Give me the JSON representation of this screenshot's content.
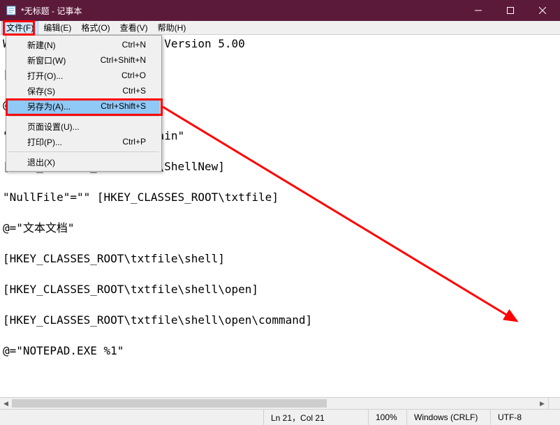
{
  "titlebar": {
    "title": "*无标题 - 记事本"
  },
  "menubar": {
    "file": "文件(F)",
    "edit": "编辑(E)",
    "format": "格式(O)",
    "view": "查看(V)",
    "help": "帮助(H)"
  },
  "dropdown": {
    "new": {
      "label": "新建(N)",
      "shortcut": "Ctrl+N"
    },
    "newwin": {
      "label": "新窗口(W)",
      "shortcut": "Ctrl+Shift+N"
    },
    "open": {
      "label": "打开(O)...",
      "shortcut": "Ctrl+O"
    },
    "save": {
      "label": "保存(S)",
      "shortcut": "Ctrl+S"
    },
    "saveas": {
      "label": "另存为(A)...",
      "shortcut": "Ctrl+Shift+S"
    },
    "pagesetup": {
      "label": "页面设置(U)...",
      "shortcut": ""
    },
    "print": {
      "label": "打印(P)...",
      "shortcut": "Ctrl+P"
    },
    "exit": {
      "label": "退出(X)",
      "shortcut": ""
    }
  },
  "editor": {
    "content": "Windows Registry Editor Version 5.00\n\n[HKEY_CLASSES_ROOT\\.txt]\n\n@=\"txtfile\"\n\n\"Content Type\"=\"text/plain\"\n\n[HKEY_CLASSES_ROOT\\.txt\\ShellNew]\n\n\"NullFile\"=\"\" [HKEY_CLASSES_ROOT\\txtfile]\n\n@=\"文本文档\"\n\n[HKEY_CLASSES_ROOT\\txtfile\\shell]\n\n[HKEY_CLASSES_ROOT\\txtfile\\shell\\open]\n\n[HKEY_CLASSES_ROOT\\txtfile\\shell\\open\\command]\n\n@=\"NOTEPAD.EXE %1\""
  },
  "statusbar": {
    "pos": "Ln 21，Col 21",
    "zoom": "100%",
    "eol": "Windows (CRLF)",
    "encoding": "UTF-8"
  }
}
